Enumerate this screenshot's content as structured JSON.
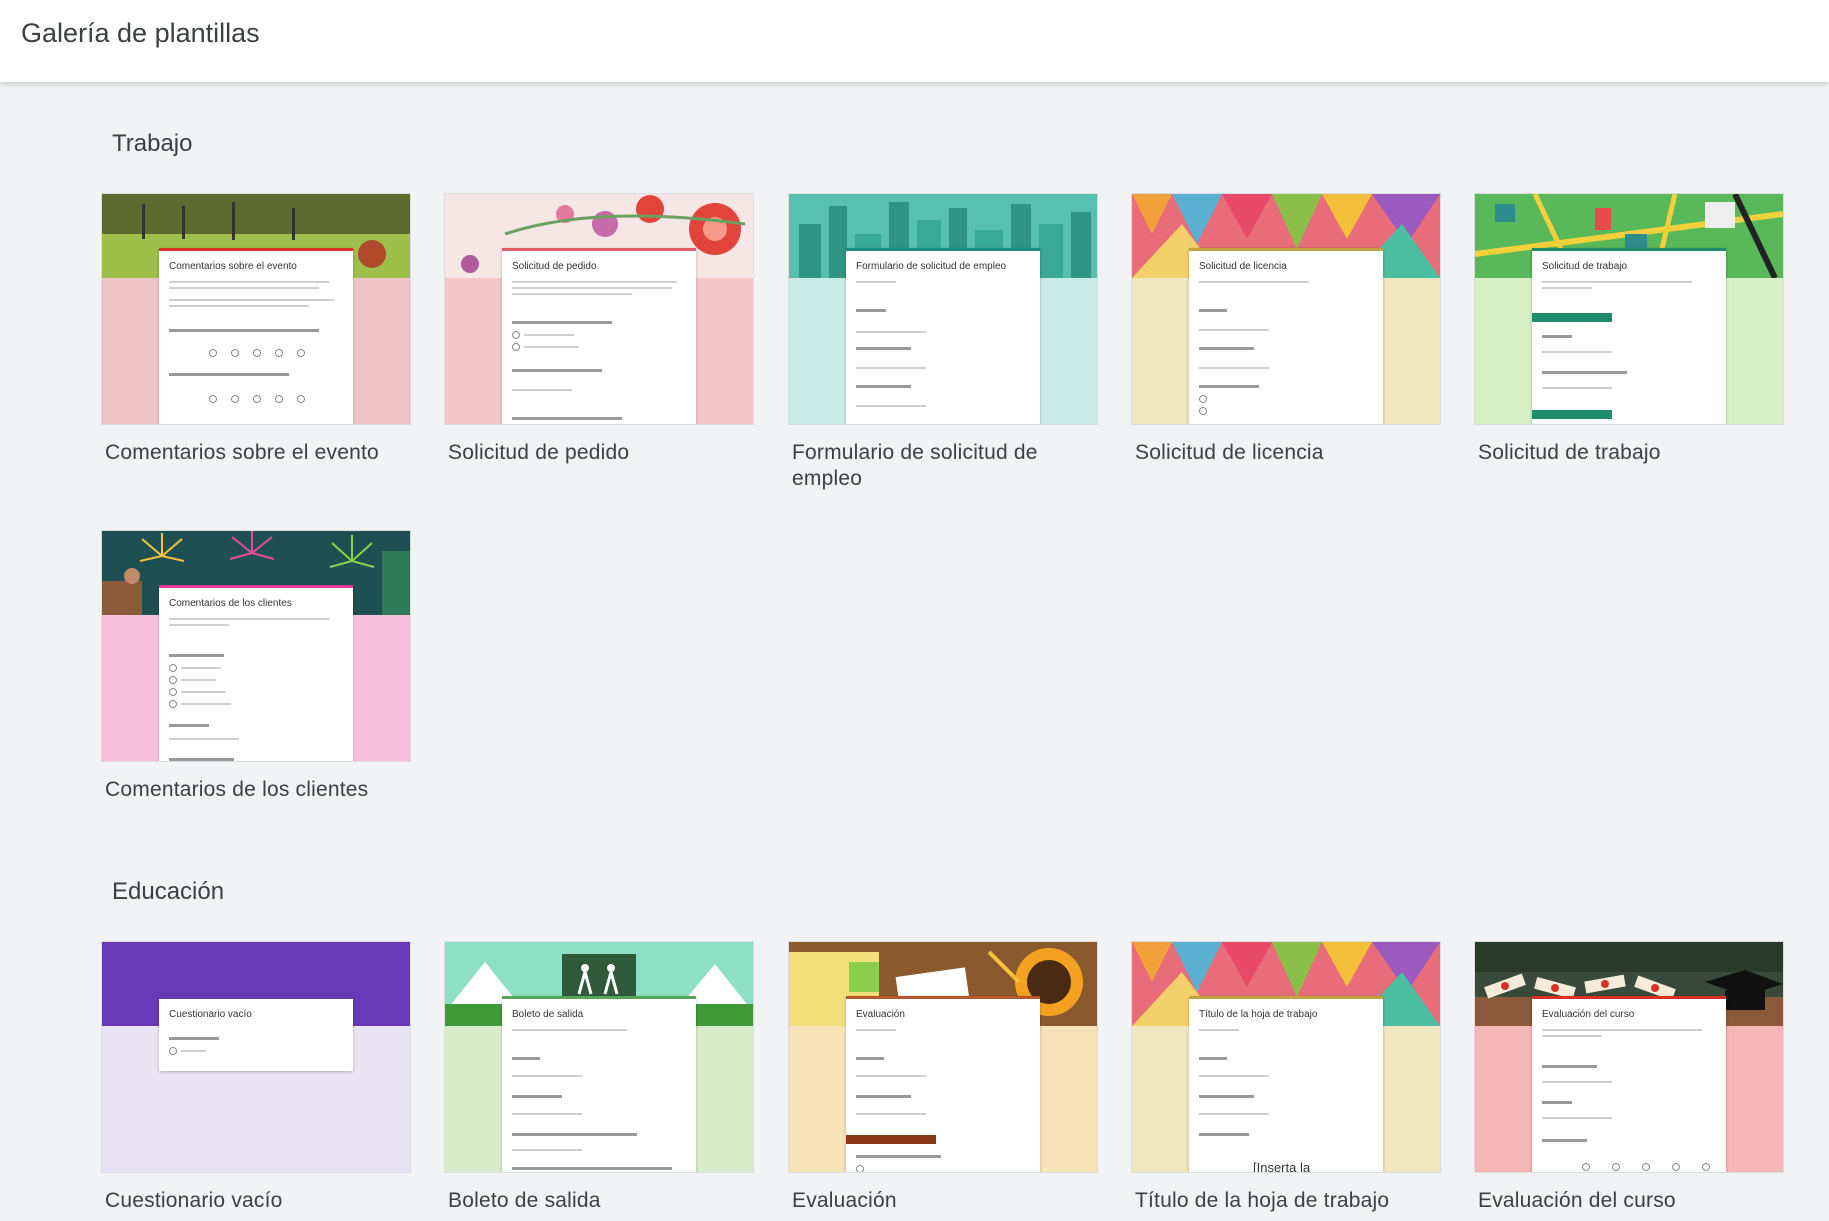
{
  "header": {
    "title": "Galería de plantillas"
  },
  "sections": [
    {
      "title": "Trabajo",
      "templates": [
        {
          "label": "Comentarios sobre el evento",
          "preview_title": "Comentarios sobre el evento",
          "banner": "#6e8a3a",
          "bottom": "#eec4c4",
          "accent": "#d93025"
        },
        {
          "label": "Solicitud de pedido",
          "preview_title": "Solicitud de pedido",
          "banner": "#f6e6e6",
          "bottom": "#f2c8c8",
          "accent": "#e35d6a"
        },
        {
          "label": "Formulario de solicitud de empleo",
          "preview_title": "Formulario de solicitud de empleo",
          "banner": "#3aa896",
          "bottom": "#c9ebe5",
          "accent": "#1e8e7e"
        },
        {
          "label": "Solicitud de licencia",
          "preview_title": "Solicitud de licencia",
          "banner": "#e86c7a",
          "bottom": "#efe7bf",
          "accent": "#c0a33b"
        },
        {
          "label": "Solicitud de trabajo",
          "preview_title": "Solicitud de trabajo",
          "banner": "#3fae6a",
          "bottom": "#d8f0c6",
          "accent": "#1f8c6e"
        },
        {
          "label": "Comentarios de los clientes",
          "preview_title": "Comentarios de los clientes",
          "banner": "#1e4f52",
          "bottom": "#f9c0dc",
          "accent": "#e4389a"
        }
      ]
    },
    {
      "title": "Educación",
      "templates": [
        {
          "label": "Cuestionario vacío",
          "preview_title": "Cuestionario vacío",
          "banner": "#673ab7",
          "bottom": "#e9e4f3",
          "accent": "#673ab7"
        },
        {
          "label": "Boleto de salida",
          "preview_title": "Boleto de salida",
          "banner": "#7fd6b7",
          "bottom": "#d9ecc9",
          "accent": "#58a45a"
        },
        {
          "label": "Evaluación",
          "preview_title": "Evaluación",
          "banner": "#9a6a3e",
          "bottom": "#f8e2b8",
          "accent": "#b4572a"
        },
        {
          "label": "Título de la hoja de trabajo",
          "preview_title": "Título de la hoja de trabajo",
          "preview_extra": "[Inserta la",
          "banner": "#e86c7a",
          "bottom": "#efe7bf",
          "accent": "#c0a33b"
        },
        {
          "label": "Evaluación del curso",
          "preview_title": "Evaluación del curso",
          "banner": "#3a4a3a",
          "bottom": "#f4b6b6",
          "accent": "#d93025"
        }
      ]
    }
  ]
}
